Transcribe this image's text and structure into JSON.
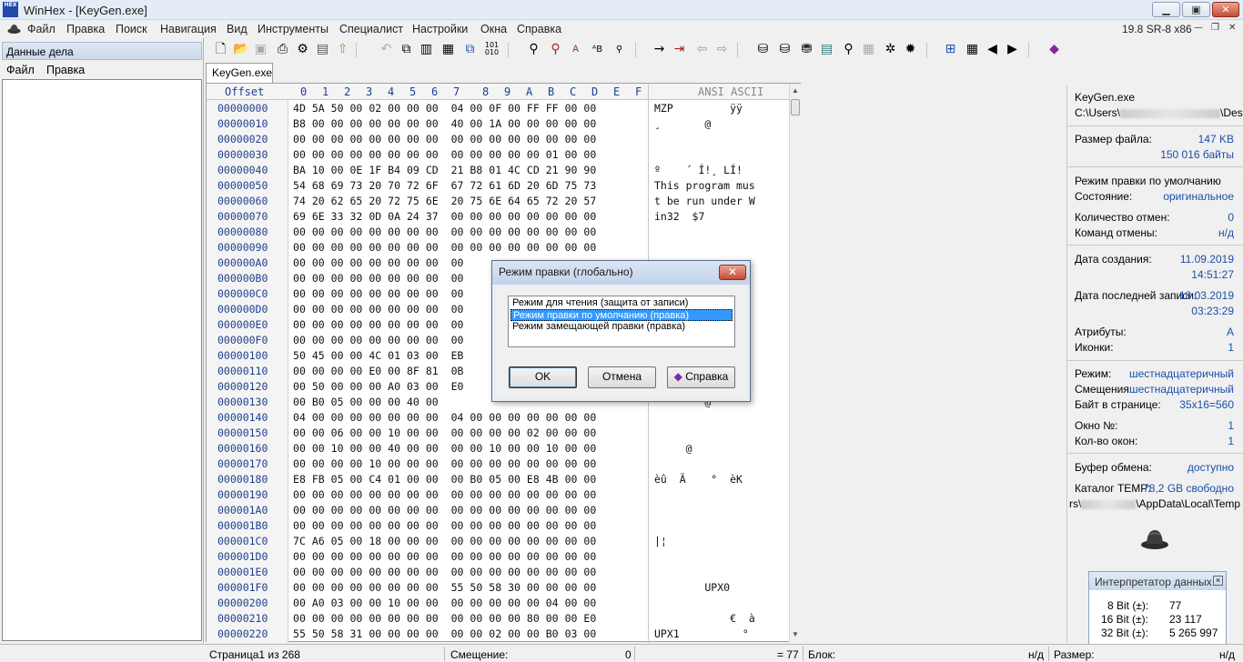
{
  "window": {
    "logo": "HEX",
    "title": "WinHex - [KeyGen.exe]",
    "minimize": "▁",
    "maximize": "▣",
    "close": "✕"
  },
  "menubar": {
    "items": [
      "Файл",
      "Правка",
      "Поиск",
      "Навигация",
      "Вид",
      "Инструменты",
      "Специалист",
      "Настройки",
      "Окна",
      "Справка"
    ],
    "version": "19.8 SR-8 x86",
    "mdi_minimize": "—",
    "mdi_restore": "❐",
    "mdi_close": "✕"
  },
  "left_panel": {
    "title": "Данные дела",
    "menu": [
      "Файл",
      "Правка"
    ]
  },
  "toolbar": {
    "icons": [
      "new-file-icon",
      "open-file-icon",
      "save-icon",
      "print-icon",
      "properties-icon",
      "open-folder-icon",
      "export-icon",
      "undo-icon",
      "copy-block-icon",
      "cut-icon",
      "paste-icon",
      "paste-special-icon",
      "binary-icon",
      "find-text-icon",
      "find-hex-icon",
      "replace-text-icon",
      "replace-hex-icon",
      "find-next-icon",
      "goto-offset-icon",
      "goto-arrow-icon",
      "back-icon",
      "forward-icon",
      "open-disk-icon",
      "disk-editor-icon",
      "clone-disk-icon",
      "ram-icon",
      "search-icon",
      "calculator-icon",
      "gear-icon",
      "hash-icon",
      "table-icon",
      "prev-icon",
      "next-icon",
      "help-book-icon"
    ]
  },
  "tab": {
    "label": "KeyGen.exe"
  },
  "hex_view": {
    "offset_header": "Offset",
    "column_headers": [
      "0",
      "1",
      "2",
      "3",
      "4",
      "5",
      "6",
      "7",
      "8",
      "9",
      "A",
      "B",
      "C",
      "D",
      "E",
      "F"
    ],
    "ascii_header": "ANSI ASCII",
    "scroll_up": "▲",
    "scroll_down": "▼",
    "rows": [
      {
        "offset": "00000000",
        "hex": "4D 5A 50 00 02 00 00 00  04 00 0F 00 FF FF 00 00",
        "ascii": "MZP         ÿÿ"
      },
      {
        "offset": "00000010",
        "hex": "B8 00 00 00 00 00 00 00  40 00 1A 00 00 00 00 00",
        "ascii": "¸       @"
      },
      {
        "offset": "00000020",
        "hex": "00 00 00 00 00 00 00 00  00 00 00 00 00 00 00 00",
        "ascii": ""
      },
      {
        "offset": "00000030",
        "hex": "00 00 00 00 00 00 00 00  00 00 00 00 00 01 00 00",
        "ascii": ""
      },
      {
        "offset": "00000040",
        "hex": "BA 10 00 0E 1F B4 09 CD  21 B8 01 4C CD 21 90 90",
        "ascii": "º    ´ Í!¸ LÍ!"
      },
      {
        "offset": "00000050",
        "hex": "54 68 69 73 20 70 72 6F  67 72 61 6D 20 6D 75 73",
        "ascii": "This program mus"
      },
      {
        "offset": "00000060",
        "hex": "74 20 62 65 20 72 75 6E  20 75 6E 64 65 72 20 57",
        "ascii": "t be run under W"
      },
      {
        "offset": "00000070",
        "hex": "69 6E 33 32 0D 0A 24 37  00 00 00 00 00 00 00 00",
        "ascii": "in32  $7"
      },
      {
        "offset": "00000080",
        "hex": "00 00 00 00 00 00 00 00  00 00 00 00 00 00 00 00",
        "ascii": ""
      },
      {
        "offset": "00000090",
        "hex": "00 00 00 00 00 00 00 00  00 00 00 00 00 00 00 00",
        "ascii": ""
      },
      {
        "offset": "000000A0",
        "hex": "00 00 00 00 00 00 00 00  00",
        "ascii": ""
      },
      {
        "offset": "000000B0",
        "hex": "00 00 00 00 00 00 00 00  00",
        "ascii": ""
      },
      {
        "offset": "000000C0",
        "hex": "00 00 00 00 00 00 00 00  00",
        "ascii": ""
      },
      {
        "offset": "000000D0",
        "hex": "00 00 00 00 00 00 00 00  00",
        "ascii": ""
      },
      {
        "offset": "000000E0",
        "hex": "00 00 00 00 00 00 00 00  00",
        "ascii": ""
      },
      {
        "offset": "000000F0",
        "hex": "00 00 00 00 00 00 00 00  00",
        "ascii": ""
      },
      {
        "offset": "00000100",
        "hex": "50 45 00 00 4C 01 03 00  EB",
        "ascii": ""
      },
      {
        "offset": "00000110",
        "hex": "00 00 00 00 E0 00 8F 81  0B",
        "ascii": ""
      },
      {
        "offset": "00000120",
        "hex": "00 50 00 00 00 A0 03 00  E0",
        "ascii": "         °"
      },
      {
        "offset": "00000130",
        "hex": "00 B0 05 00 00 00 40 00",
        "ascii": "        @"
      },
      {
        "offset": "00000140",
        "hex": "04 00 00 00 00 00 00 00  04 00 00 00 00 00 00 00",
        "ascii": ""
      },
      {
        "offset": "00000150",
        "hex": "00 00 06 00 00 10 00 00  00 00 00 00 02 00 00 00",
        "ascii": ""
      },
      {
        "offset": "00000160",
        "hex": "00 00 10 00 00 40 00 00  00 00 10 00 00 10 00 00",
        "ascii": "     @"
      },
      {
        "offset": "00000170",
        "hex": "00 00 00 00 10 00 00 00  00 00 00 00 00 00 00 00",
        "ascii": ""
      },
      {
        "offset": "00000180",
        "hex": "E8 FB 05 00 C4 01 00 00  00 B0 05 00 E8 4B 00 00",
        "ascii": "èû  Ä    °  èK"
      },
      {
        "offset": "00000190",
        "hex": "00 00 00 00 00 00 00 00  00 00 00 00 00 00 00 00",
        "ascii": ""
      },
      {
        "offset": "000001A0",
        "hex": "00 00 00 00 00 00 00 00  00 00 00 00 00 00 00 00",
        "ascii": ""
      },
      {
        "offset": "000001B0",
        "hex": "00 00 00 00 00 00 00 00  00 00 00 00 00 00 00 00",
        "ascii": ""
      },
      {
        "offset": "000001C0",
        "hex": "7C A6 05 00 18 00 00 00  00 00 00 00 00 00 00 00",
        "ascii": "|¦"
      },
      {
        "offset": "000001D0",
        "hex": "00 00 00 00 00 00 00 00  00 00 00 00 00 00 00 00",
        "ascii": ""
      },
      {
        "offset": "000001E0",
        "hex": "00 00 00 00 00 00 00 00  00 00 00 00 00 00 00 00",
        "ascii": ""
      },
      {
        "offset": "000001F0",
        "hex": "00 00 00 00 00 00 00 00  55 50 58 30 00 00 00 00",
        "ascii": "        UPX0"
      },
      {
        "offset": "00000200",
        "hex": "00 A0 03 00 00 10 00 00  00 00 00 00 00 04 00 00",
        "ascii": ""
      },
      {
        "offset": "00000210",
        "hex": "00 00 00 00 00 00 00 00  00 00 00 00 80 00 00 E0",
        "ascii": "            €  à"
      },
      {
        "offset": "00000220",
        "hex": "55 50 58 31 00 00 00 00  00 00 02 00 00 B0 03 00",
        "ascii": "UPX1          °"
      }
    ]
  },
  "info_panel": {
    "filename": "KeyGen.exe",
    "path_prefix": "C:\\Users\\",
    "path_suffix": "\\Desk",
    "file_size_label": "Размер файла:",
    "file_size_kb": "147 KB",
    "file_size_bytes": "150 016 байты",
    "edit_mode_label": "Режим правки по умолчанию",
    "state_label": "Состояние:",
    "state_value": "оригинальное",
    "undo_count_label": "Количество отмен:",
    "undo_count_value": "0",
    "undo_cmds_label": "Команд отмены:",
    "undo_cmds_value": "н/д",
    "created_label": "Дата создания:",
    "created_date": "11.09.2019",
    "created_time": "14:51:27",
    "modified_label": "Дата последней записи:",
    "modified_date": "18.03.2019",
    "modified_time": "03:23:29",
    "attributes_label": "Атрибуты:",
    "attributes_value": "A",
    "icons_label": "Иконки:",
    "icons_value": "1",
    "mode_label": "Режим:",
    "mode_value": "шестнадцатеричный",
    "offsets_label": "Смещения:",
    "offsets_value": "шестнадцатеричный",
    "bytes_page_label": "Байт в странице:",
    "bytes_page_value": "35x16=560",
    "window_no_label": "Окно №:",
    "window_no_value": "1",
    "windows_count_label": "Кол-во окон:",
    "windows_count_value": "1",
    "clipboard_label": "Буфер обмена:",
    "clipboard_value": "доступно",
    "temp_label": "Каталог TEMP:",
    "temp_value": "78,2 GB свободно",
    "temp_path_prefix": "rs\\",
    "temp_path_suffix": "\\AppData\\Local\\Temp"
  },
  "interpreter": {
    "title": "Интерпретатор данных",
    "close": "×",
    "rows": [
      {
        "label": "8 Bit (±):",
        "value": "77"
      },
      {
        "label": "16 Bit (±):",
        "value": "23 117"
      },
      {
        "label": "32 Bit (±):",
        "value": "5 265 997"
      }
    ]
  },
  "status_bar": {
    "page": "Страница1 из 268",
    "offset_label": "Смещение:",
    "offset_value": "0",
    "eq_value": "= 77",
    "block_label": "Блок:",
    "block_value": "н/д",
    "size_label": "Размер:",
    "size_value": "н/д"
  },
  "dialog": {
    "title": "Режим правки (глобально)",
    "close": "✕",
    "options": [
      "Режим для чтения (защита от записи)",
      "Режим правки по умолчанию (правка)",
      "Режим замещающей правки (правка)"
    ],
    "selected_index": 1,
    "ok_label": "OK",
    "cancel_label": "Отмена",
    "help_label": "Справка"
  },
  "colors": {
    "accent": "#3399ff",
    "offset_text": "#1f3f8f",
    "info_value": "#1a4fa8"
  }
}
